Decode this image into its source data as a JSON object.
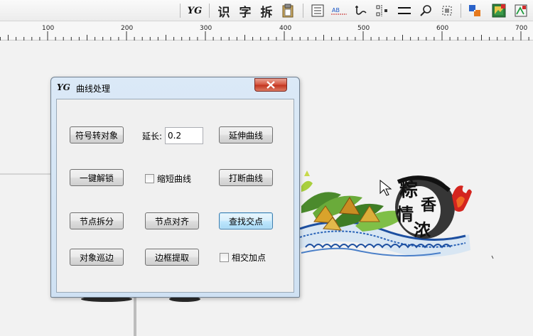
{
  "toolbar": {
    "logo": "YG",
    "char_buttons": [
      "识",
      "字",
      "拆"
    ],
    "icons": [
      "clipboard-icon",
      "list-icon",
      "ab-text-icon",
      "wave-curve-icon",
      "node-align-icon",
      "horizontal-lines-icon",
      "find-replace-icon",
      "select-box-icon",
      "color-swap-icon",
      "image-frame-icon",
      "bitmap-trace-icon"
    ]
  },
  "ruler": {
    "labels": [
      "100",
      "200",
      "300",
      "400",
      "500",
      "600",
      "700"
    ]
  },
  "dialog": {
    "logo": "YG",
    "title": "曲线处理",
    "close_label": "×",
    "buttons": {
      "symbol_to_object": "符号转对象",
      "extend_curve": "延伸曲线",
      "one_click_unlock": "一键解锁",
      "break_curve": "打断曲线",
      "node_split": "节点拆分",
      "node_align": "节点对齐",
      "find_intersection": "查找交点",
      "object_trace_edge": "对象巡边",
      "extract_frame": "边框提取"
    },
    "extend_label": "延长:",
    "extend_value": "0.2",
    "checkboxes": {
      "shorten_curve": "缩短曲线",
      "add_intersection_points": "相交加点"
    }
  },
  "artwork": {
    "calligraphy": [
      "粽",
      "香",
      "情",
      "浓"
    ]
  }
}
